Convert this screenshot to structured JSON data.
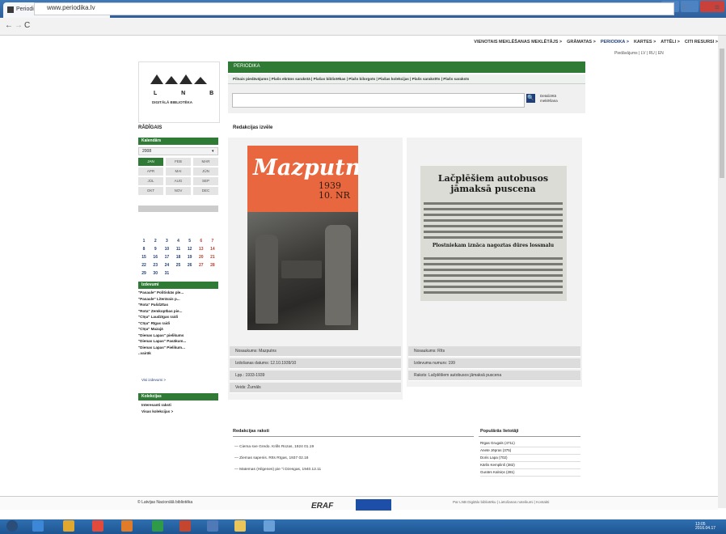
{
  "browser": {
    "tab_title": "Periodika — Latvijas Naci",
    "url": "www.periodika.lv"
  },
  "topnav": [
    "VIENOTAIS MEKLĒŠANAS MEKLĒTĀJS >",
    "GRĀMATAS >",
    "PERIODIKA >",
    "KARTES >",
    "ATTĒLI >",
    "CITI RESURSI >"
  ],
  "lang": "Piedāvājums | LV | RU | EN",
  "logo": {
    "letters": "L N B",
    "text": "DIGITĀLĀ BIBLIOTĒKA"
  },
  "header": {
    "section": "PERIODIKA",
    "subnav": "Pilnais piedāvājums | Plašs ekrāns sarakstā | Plašas bibliotēkas | Plašs bilorgots | Plašas kolekcijas | Plašs sarakstīts | Plašs saraksts"
  },
  "search": {
    "placeholder": "",
    "button": "🔍",
    "advanced": "Detalizētā meklēšana"
  },
  "sidebar": {
    "title": "RĀDĪGAIS",
    "calendar_header": "Kalendārs",
    "year": "2008",
    "months": [
      "JAN",
      "FEB",
      "MAR",
      "APR",
      "MAI",
      "JŪN",
      "JŪL",
      "AUG",
      "SEP",
      "OKT",
      "NOV",
      "DEC"
    ],
    "days": [
      "",
      "",
      "",
      "",
      "",
      "",
      "",
      "",
      "",
      "",
      "",
      "",
      "",
      "",
      "",
      "",
      "",
      "",
      "",
      "",
      "",
      "1",
      "2",
      "3",
      "4",
      "5",
      "6",
      "7",
      "8",
      "9",
      "10",
      "11",
      "12",
      "13",
      "14",
      "15",
      "16",
      "17",
      "18",
      "19",
      "20",
      "21",
      "22",
      "23",
      "24",
      "25",
      "26",
      "27",
      "28",
      "29",
      "30",
      "31",
      "",
      "",
      "",
      ""
    ],
    "news_header": "Izdevumi",
    "news": [
      "\"Pasaule\" Politiskās ple...",
      "\"Pasaule\" Literārais p...",
      "\"Rota\" Pašdzītas",
      "\"Rota\" Zemkopības pie...",
      "\"Cīņa\" Laudzīgas raidi",
      "\"Cīņa\" Rīgas raidi",
      "\"Cīņa\" Mazajā",
      "\"Dienas Lapas\" pielikums",
      "\"Dienas Lapas\" Pasākum...",
      "\"Dienas Lapas\" Pielikum...",
      "..vairāk"
    ],
    "more": "Visi izdevumi >",
    "coll_header": "Kolekcijas",
    "collections": [
      "Interesanti raksti",
      "Visas kolekcijas >"
    ]
  },
  "main": {
    "title": "Redakcijas izvēle",
    "cover": {
      "title": "Mazputns",
      "year": "1939",
      "issue": "10. NR"
    },
    "card1_meta": [
      "Nosaukums:   Mazputns",
      "Izdošanas datums:   12.10.1939/10",
      "Lpp.:   1933-1939",
      "Veids:   Žurnāls"
    ],
    "clipping": {
      "title": "Lačplēšiem autobusos jāmaksā puscena",
      "subtitle": "Plostniekam iznāca nagoztas dūres lossmalu"
    },
    "card2_meta": [
      "Nosaukums:   Rīts",
      "Izdevuma numurs:   199",
      "Raksts:   Lačplēšiem autobusos jāmaksā puscena"
    ]
  },
  "related": {
    "title": "Redakcijas raksti",
    "items": [
      "— Ciema sve Gredo. Krills Rozas, 1924 01.19",
      "— Ziemas sapenis. Rīts Rīgas, 1937 02.18",
      "— Matemas (Hilgenes) pie \"i Dzesgas, 1940.12.11"
    ]
  },
  "popular": {
    "title": "Populārās lietotāji",
    "items": [
      "Rīgas Grugals (4711)",
      "Anete Jēpras (375)",
      "Doris Lapa (702)",
      "Kārlis Kemplinš (382)",
      "Gunārs Kalniņs (281)"
    ]
  },
  "footer": {
    "left": "© Latvijas Nacionālā bibliotēka",
    "erf": "ERAF",
    "right": "Par LNB Digitālo bibliotēku | Lietošanas noteikumi | Kontakti"
  },
  "taskbar": {
    "time": "13:05",
    "date": "2016.04.17"
  },
  "colors": {
    "green": "#2f7a35",
    "navy": "#1f3f7a",
    "cover_orange": "#e8673f"
  }
}
